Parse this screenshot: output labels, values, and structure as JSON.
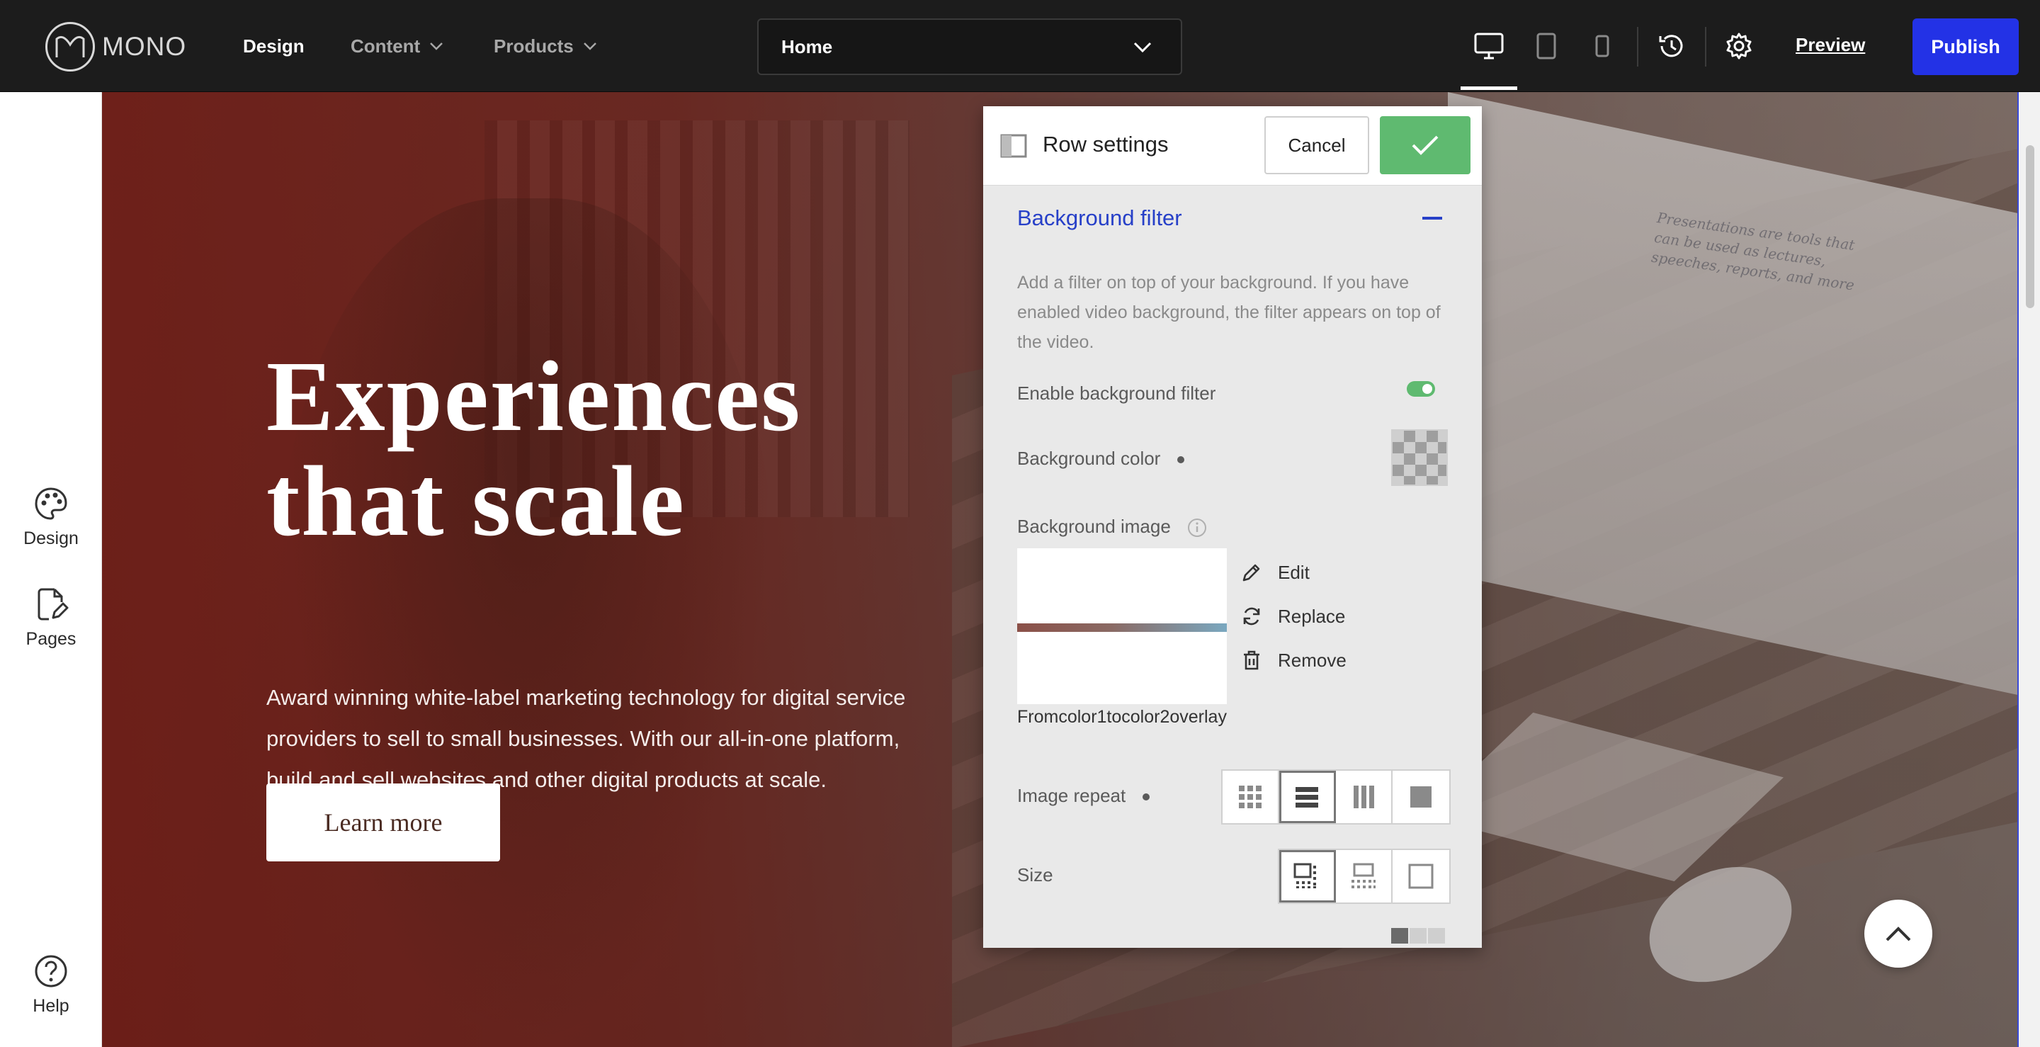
{
  "topbar": {
    "logo_text": "MONO",
    "nav": [
      {
        "label": "Design",
        "active": true,
        "has_menu": false
      },
      {
        "label": "Content",
        "active": false,
        "has_menu": true
      },
      {
        "label": "Products",
        "active": false,
        "has_menu": true
      }
    ],
    "page_select": {
      "value": "Home",
      "icon": "chevron-down-icon"
    },
    "device_icons": [
      "desktop-icon",
      "tablet-icon",
      "mobile-icon"
    ],
    "active_device": "desktop",
    "history_icon": "history-icon",
    "settings_icon": "gear-icon",
    "preview_label": "Preview",
    "publish_label": "Publish",
    "colors": {
      "bar": "#1c1c1c",
      "publish": "#2332e6"
    }
  },
  "leftrail": {
    "items": [
      {
        "label": "Design",
        "icon": "palette-icon"
      },
      {
        "label": "Pages",
        "icon": "pages-edit-icon"
      },
      {
        "label": "Help",
        "icon": "help-icon"
      }
    ]
  },
  "hero": {
    "title_line1": "Experiences",
    "title_line2": "that scale",
    "subtitle": "Award winning white-label marketing technology for digital service providers to sell to small businesses. With our all-in-one platform, build and sell websites and other digital products at scale.",
    "button_label": "Learn more",
    "monitor_text": "Presentations are tools that can be used as lectures, speeches, reports, and more",
    "scroll_top_icon": "chevron-up-icon"
  },
  "panel": {
    "title": "Row settings",
    "panel_icon": "layout-split-icon",
    "cancel_label": "Cancel",
    "confirm_icon": "check-icon",
    "section_title": "Background filter",
    "collapse_icon": "minus-icon",
    "description": "Add a filter on top of your background. If you have enabled video background, the filter appears on top of the video.",
    "enable_filter_label": "Enable background filter",
    "enable_filter_on": true,
    "bg_color_label": "Background color",
    "bg_image_label": "Background image",
    "info_icon": "info-icon",
    "image_caption": "Fromcolor1tocolor2overlay",
    "image_actions": [
      {
        "label": "Edit",
        "icon": "pencil-icon"
      },
      {
        "label": "Replace",
        "icon": "replace-icon"
      },
      {
        "label": "Remove",
        "icon": "trash-icon"
      }
    ],
    "image_repeat_label": "Image repeat",
    "image_repeat_options": [
      "repeat-grid-icon",
      "repeat-horizontal-icon",
      "repeat-vertical-icon",
      "no-repeat-icon"
    ],
    "image_repeat_selected": 1,
    "size_label": "Size",
    "size_options": [
      "size-auto-icon",
      "size-cover-icon",
      "size-contain-icon"
    ],
    "size_selected": 0,
    "colors": {
      "accent": "#2740c8",
      "confirm": "#5fba70",
      "toggle_on": "#5fba70"
    }
  }
}
